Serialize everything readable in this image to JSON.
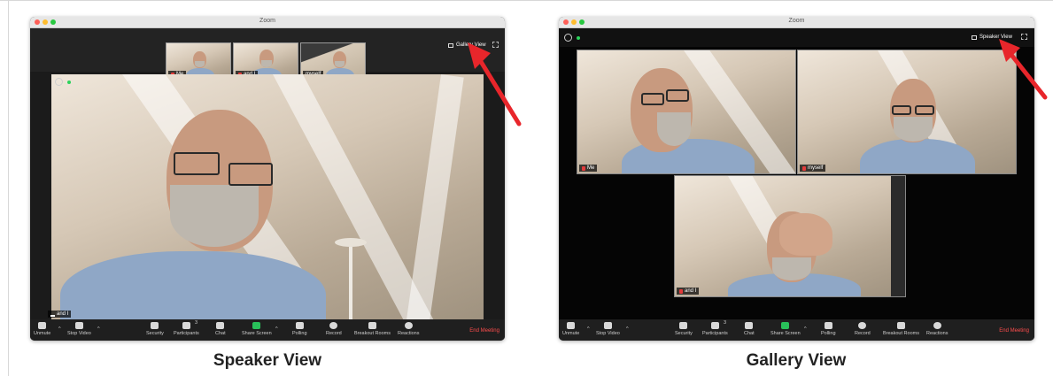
{
  "speaker_window": {
    "title": "Zoom",
    "view_button": "Gallery View",
    "thumbnails": [
      "Me",
      "and I",
      "myself"
    ],
    "main_name": "and I"
  },
  "gallery_window": {
    "title": "Zoom",
    "view_button": "Speaker View",
    "tiles": [
      "Me",
      "myself",
      "and I"
    ]
  },
  "toolbar": {
    "unmute": "Unmute",
    "stop_video": "Stop Video",
    "security": "Security",
    "participants": "Participants",
    "participants_count": "3",
    "chat": "Chat",
    "share_screen": "Share Screen",
    "polling": "Polling",
    "record": "Record",
    "breakout_rooms": "Breakout Rooms",
    "reactions": "Reactions",
    "end_meeting": "End Meeting"
  },
  "captions": {
    "left": "Speaker View",
    "right": "Gallery View"
  },
  "colors": {
    "arrow": "#e8262b",
    "end_meeting": "#ff4d4d",
    "share": "#29c05a",
    "mute_flag": "#e23b3b"
  }
}
